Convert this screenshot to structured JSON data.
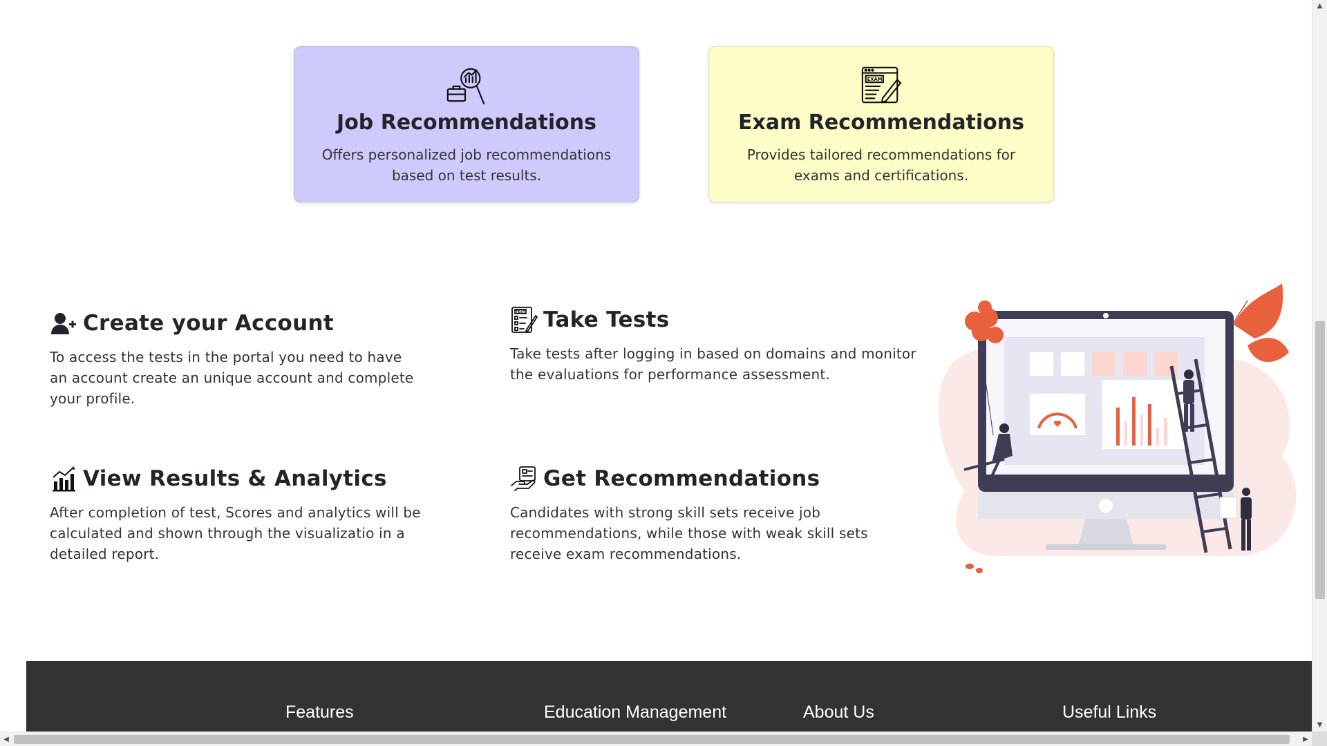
{
  "cards": [
    {
      "title": "Job Recommendations",
      "description": "Offers personalized job recommendations based on test results.",
      "icon": "job-search-icon",
      "bg": "#cccbfc"
    },
    {
      "title": "Exam Recommendations",
      "description": "Provides tailored recommendations for exams and certifications.",
      "icon": "exam-icon",
      "bg": "#fdfdc7"
    }
  ],
  "steps": [
    {
      "title": "Create your Account",
      "description": "To access the tests in the portal you need to have an account create an unique account and complete your profile.",
      "icon": "user-plus-icon"
    },
    {
      "title": "Take Tests",
      "description": "Take tests after logging in based on domains and monitor the evaluations for performance assessment.",
      "icon": "test-checklist-icon"
    },
    {
      "title": "View Results & Analytics",
      "description": "After completion of test, Scores and analytics will be calculated and shown through the visualizatio in a detailed report.",
      "icon": "bar-chart-icon"
    },
    {
      "title": "Get Recommendations",
      "description": "Candidates with strong skill sets receive job recommendations, while those with weak skill sets receive exam recommendations.",
      "icon": "hand-card-icon"
    }
  ],
  "illustration": {
    "icon": "dashboard-illustration"
  },
  "footer": {
    "columns": [
      "Features",
      "Education Management",
      "About Us",
      "Useful Links"
    ],
    "bg": "#333333"
  },
  "colors": {
    "accent_orange": "#e8603c",
    "navy": "#3f3d56"
  }
}
